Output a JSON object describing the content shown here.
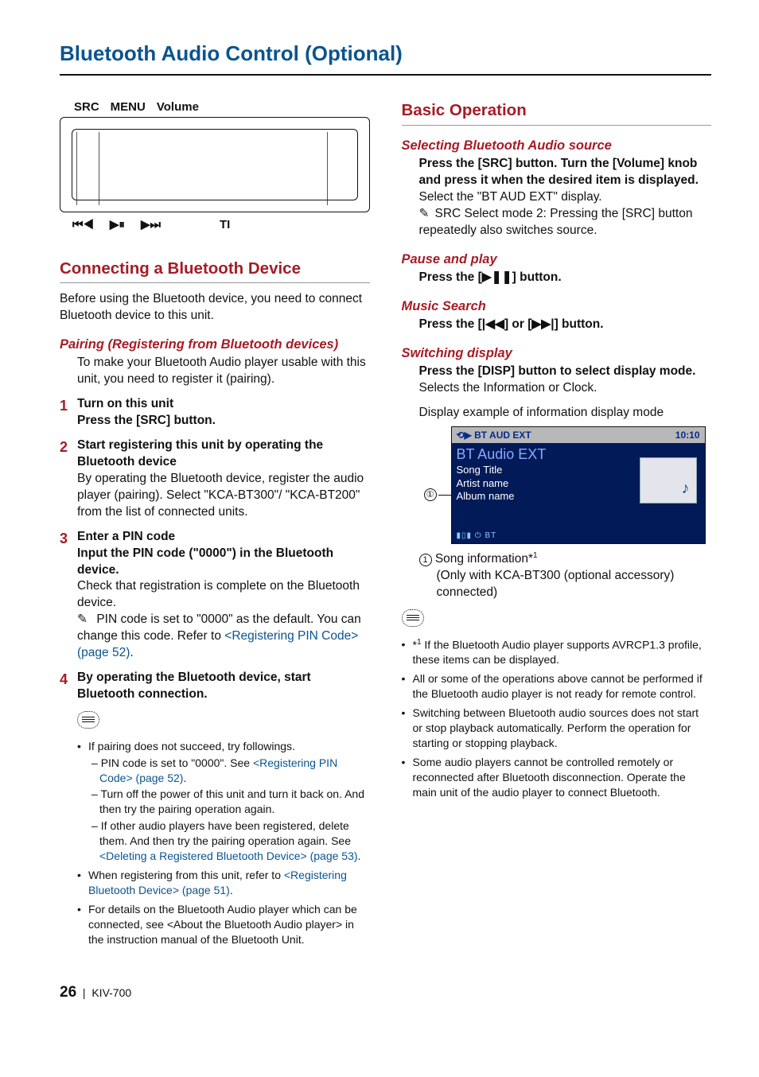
{
  "page": {
    "number": "26",
    "model": "KIV-700",
    "separator": "|"
  },
  "chapter_title": "Bluetooth Audio Control (Optional)",
  "device": {
    "labels_top": [
      "SRC",
      "MENU",
      "Volume"
    ],
    "labels_bottom": {
      "prev": "⏮◀",
      "play": "▶⏸",
      "next": "▶⏭",
      "ti": "TI"
    }
  },
  "left": {
    "section1": "Connecting a Bluetooth Device",
    "intro": "Before using the Bluetooth device, you need to connect Bluetooth device to this unit.",
    "pairing_head": "Pairing (Registering from Bluetooth devices)",
    "pairing_body": "To make your Bluetooth Audio player usable with this unit, you need to register it (pairing).",
    "steps": [
      {
        "n": "1",
        "title": "Turn on this unit",
        "bold2": "Press the [SRC] button."
      },
      {
        "n": "2",
        "title": "Start registering this unit by operating the Bluetooth device",
        "body": "By operating the Bluetooth device, register the audio player (pairing). Select \"KCA-BT300\"/ \"KCA-BT200\" from the list of connected units."
      },
      {
        "n": "3",
        "title": "Enter a PIN code",
        "bold2": "Input the PIN code (\"0000\") in the Bluetooth device.",
        "body": "Check that registration is complete on the Bluetooth device.",
        "pencil_pre": "PIN code is set to \"0000\" as the default. You can change this code. Refer to ",
        "pencil_link": "<Registering PIN Code> (page 52)",
        "pencil_post": "."
      },
      {
        "n": "4",
        "title": "By operating the Bluetooth device, start Bluetooth connection."
      }
    ],
    "notes": {
      "n1": "If pairing does not succeed, try followings.",
      "n1a_pre": "PIN code is set to \"0000\". See ",
      "n1a_link": "<Registering PIN Code> (page 52)",
      "n1a_post": ".",
      "n1b": "Turn off the power of this unit and turn it back on. And then try the pairing operation again.",
      "n1c_pre": "If other audio players have been registered, delete them. And then try the pairing operation again. See ",
      "n1c_link": "<Deleting a Registered Bluetooth Device> (page 53)",
      "n1c_post": ".",
      "n2_pre": "When registering from this unit, refer to ",
      "n2_link": "<Registering Bluetooth Device> (page 51)",
      "n2_post": ".",
      "n3": "For details on the Bluetooth Audio player which can be connected, see <About the Bluetooth Audio player> in the instruction manual of the Bluetooth Unit."
    }
  },
  "right": {
    "section": "Basic Operation",
    "sub1": {
      "head": "Selecting Bluetooth Audio source",
      "b1": "Press the [SRC] button. Turn the [Volume] knob and press it when the desired item is displayed.",
      "p1": "Select the \"BT AUD EXT\"  display.",
      "pencil": "SRC Select mode 2: Pressing the [SRC] button repeatedly also switches source."
    },
    "sub2": {
      "head": "Pause and play",
      "b_pre": "Press the [",
      "b_icon": "▶❚❚",
      "b_post": "] button."
    },
    "sub3": {
      "head": "Music Search",
      "b_pre": "Press the [",
      "b_icon1": "|◀◀",
      "b_mid": "] or [",
      "b_icon2": "▶▶|",
      "b_post": "] button."
    },
    "sub4": {
      "head": "Switching display",
      "b1": "Press the [DISP] button to select display mode.",
      "p1": "Selects the Information or Clock.",
      "caption": "Display example of information display mode"
    },
    "display": {
      "top_left_icon": "⟲▶",
      "top_left": "BT AUD EXT",
      "top_right": "10:10",
      "title": "BT Audio EXT",
      "line1": "Song Title",
      "line2": "Artist name",
      "line3": "Album name",
      "status": "▮▯▮ ⏻ BT",
      "pointer": "①"
    },
    "after_display": {
      "line1_pre": "Song information*",
      "line1_sup": "1",
      "line2": "(Only with KCA-BT300 (optional accessory) connected)"
    },
    "notes": [
      "*1 If the Bluetooth Audio player supports AVRCP1.3 profile, these items can be displayed.",
      "All or some of the operations above cannot be performed if the Bluetooth audio player is not ready for remote control.",
      "Switching between Bluetooth audio sources does not start or stop playback automatically. Perform the operation for starting or stopping playback.",
      "Some audio players cannot be controlled remotely or reconnected after Bluetooth disconnection. Operate the main unit of the audio player to connect Bluetooth."
    ]
  }
}
